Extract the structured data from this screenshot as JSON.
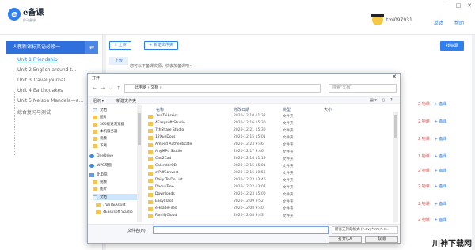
{
  "app": {
    "logo_char": "e",
    "logo_title": "e备课",
    "logo_sub": "移动备课",
    "username": "tmi097931",
    "feedback": "反馈",
    "help": "帮助",
    "win_controls": [
      "—",
      "□",
      "✕"
    ]
  },
  "sidebar": {
    "book": "人教新课标英语必修一",
    "swap_icon": "⇄",
    "units": [
      {
        "label": "Unit 1 Friendship",
        "active": true
      },
      {
        "label": "Unit 2 English around t...",
        "active": false
      },
      {
        "label": "Unit 3 Travel journal",
        "active": false
      },
      {
        "label": "Unit 4 Earthquakes",
        "active": false
      },
      {
        "label": "Unit 5 Nelson Mandela—a...",
        "active": false
      },
      {
        "label": "综合复习与测试",
        "active": false
      }
    ]
  },
  "main": {
    "upload_btn": "上传",
    "new_folder_btn": "新建文件夹",
    "primary_btn": "找资源",
    "tab": "上传",
    "notice": "您可以下备课资源，快去加备课吧~",
    "rows": [
      {
        "count": "2 物课",
        "action": "+ 备课"
      },
      {
        "count": "2 物课",
        "action": "+ 备课"
      },
      {
        "count": "2 物课",
        "action": "+ 备课"
      },
      {
        "count": "1 物课",
        "action": "+ 备课"
      },
      {
        "count": "2 物课",
        "action": "+ 备课"
      },
      {
        "count": "2 物课",
        "action": "+ 备课"
      },
      {
        "count": "2 物课",
        "action": "+ 备课"
      },
      {
        "count": "2 物课",
        "action": "+ 备课"
      }
    ]
  },
  "dialog": {
    "title": "打开",
    "close": "✕",
    "path": [
      "此电脑",
      "文档"
    ],
    "search_placeholder": "搜索\"文档\"",
    "commands": [
      "组织 ▾",
      "新建文件夹"
    ],
    "nav_items": [
      {
        "label": "文档",
        "icon": "doc"
      },
      {
        "label": "图片",
        "icon": "folder"
      },
      {
        "label": "360极速浏览器",
        "icon": "folder"
      },
      {
        "label": "本机服务器",
        "icon": "folder"
      },
      {
        "label": "视频",
        "icon": "folder"
      },
      {
        "label": "下载",
        "icon": "folder"
      },
      {
        "label": "OneDrive",
        "icon": "cloud"
      },
      {
        "label": "WPS网盘",
        "icon": "cloud"
      },
      {
        "label": "此电脑",
        "icon": "pc"
      },
      {
        "label": "视频",
        "icon": "folder"
      },
      {
        "label": "图片",
        "icon": "folder"
      },
      {
        "label": "文档",
        "icon": "doc",
        "selected": true
      },
      {
        "label": ".YunTaiAssist",
        "icon": "folder"
      },
      {
        "label": "4Easysoft Studio",
        "icon": "folder"
      }
    ],
    "columns": [
      "名称",
      "修改日期",
      "类型",
      "大小"
    ],
    "files": [
      {
        "name": ".YunTaiAssist",
        "date": "2020-12-10 11:32",
        "type": "文件夹"
      },
      {
        "name": "4Easysoft Studio",
        "date": "2020-12-16 15:30",
        "type": "文件夹"
      },
      {
        "name": "7thShare Studio",
        "date": "2020-12-21 15:30",
        "type": "文件夹"
      },
      {
        "name": "12XueDocs",
        "date": "2020-12-15 15:01",
        "type": "文件夹"
      },
      {
        "name": "Amped Authenticate",
        "date": "2020-12-23 9:46",
        "type": "文件夹"
      },
      {
        "name": "AnyMP4 Studio",
        "date": "2020-12-17 9:46",
        "type": "文件夹"
      },
      {
        "name": "Cad2Cad",
        "date": "2020-12-14 11:19",
        "type": "文件夹"
      },
      {
        "name": "CalendarOB",
        "date": "2020-12-15 15:01",
        "type": "文件夹"
      },
      {
        "name": "ctPdfConvert",
        "date": "2020-12-15 10:56",
        "type": "文件夹"
      },
      {
        "name": "Daily To-Do List",
        "date": "2020-12-23 13:46",
        "type": "文件夹"
      },
      {
        "name": "DocuxTree",
        "date": "2020-12-22 13:07",
        "type": "文件夹"
      },
      {
        "name": "Downloads",
        "date": "2020-12-23 15:00",
        "type": "文件夹"
      },
      {
        "name": "EasyClass",
        "date": "2020-12-09 9:52",
        "type": "文件夹"
      },
      {
        "name": "eHeadeFiles",
        "date": "2020-12-08 9:40",
        "type": "文件夹"
      },
      {
        "name": "FamilyCloud",
        "date": "2020-12-08 9:43",
        "type": "文件夹"
      }
    ],
    "filename_label": "文件名(N):",
    "filename_value": "",
    "filetype": "所有支持的格式 (*.avi;*.rm;*.rr...",
    "open_btn": "打开(O)",
    "cancel_btn": "取消"
  },
  "watermark": "川神下载网"
}
